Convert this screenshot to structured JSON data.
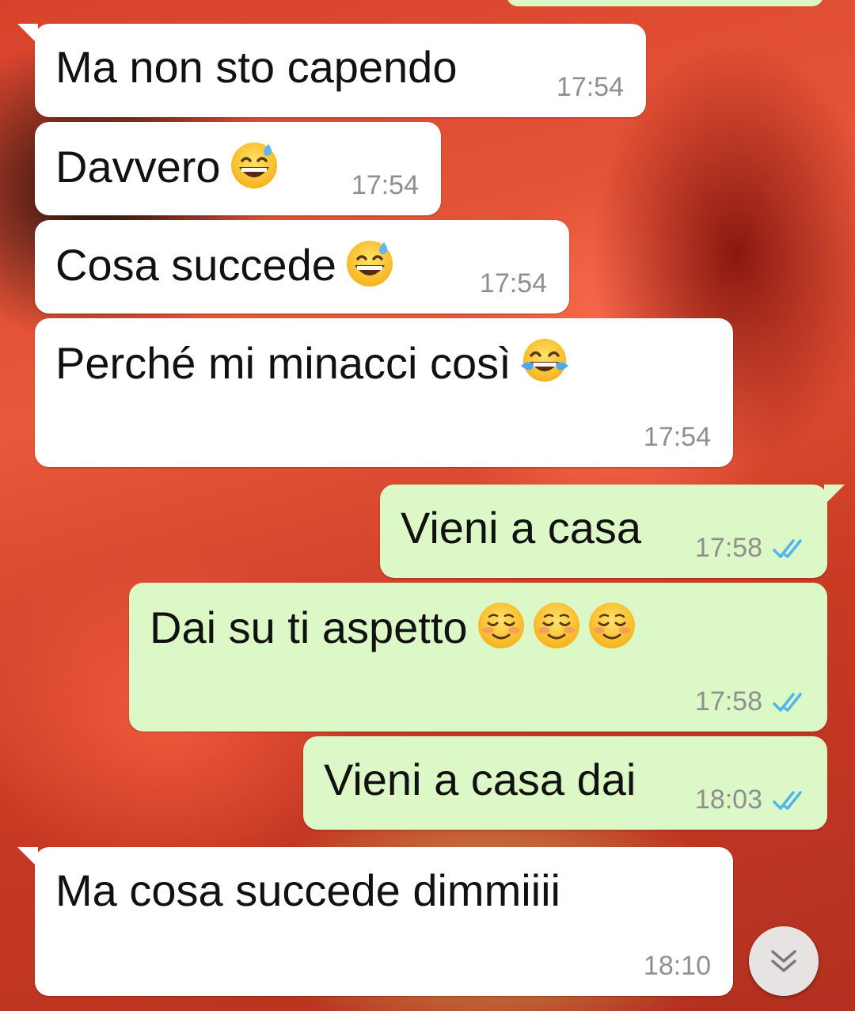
{
  "chat": {
    "messages": [
      {
        "id": "m1",
        "direction": "in",
        "text": "Ma non sto capendo",
        "emojis": [],
        "time": "17:54"
      },
      {
        "id": "m2",
        "direction": "in",
        "text": "Davvero",
        "emojis": [
          "grinning-sweat"
        ],
        "time": "17:54"
      },
      {
        "id": "m3",
        "direction": "in",
        "text": "Cosa succede",
        "emojis": [
          "grinning-sweat"
        ],
        "time": "17:54"
      },
      {
        "id": "m4",
        "direction": "in",
        "text": "Perché mi minacci così",
        "emojis": [
          "tears-of-joy"
        ],
        "time": "17:54"
      },
      {
        "id": "m5",
        "direction": "out",
        "text": "Vieni a casa",
        "emojis": [],
        "time": "17:58",
        "status": "read"
      },
      {
        "id": "m6",
        "direction": "out",
        "text": "Dai su ti aspetto",
        "emojis": [
          "smiling-blush",
          "smiling-blush",
          "smiling-blush"
        ],
        "time": "17:58",
        "status": "read"
      },
      {
        "id": "m7",
        "direction": "out",
        "text": "Vieni a casa dai",
        "emojis": [],
        "time": "18:03",
        "status": "read"
      },
      {
        "id": "m8",
        "direction": "in",
        "text": "Ma cosa succede dimmiiii",
        "emojis": [],
        "time": "18:10"
      }
    ]
  },
  "colors": {
    "incoming_bubble": "#ffffff",
    "outgoing_bubble": "#dcf8c6",
    "read_ticks": "#4fb6ec",
    "timestamp": "#8f8f8f"
  },
  "icons": {
    "read_status": "double-check-icon",
    "scroll_button": "chevron-double-down-icon"
  }
}
